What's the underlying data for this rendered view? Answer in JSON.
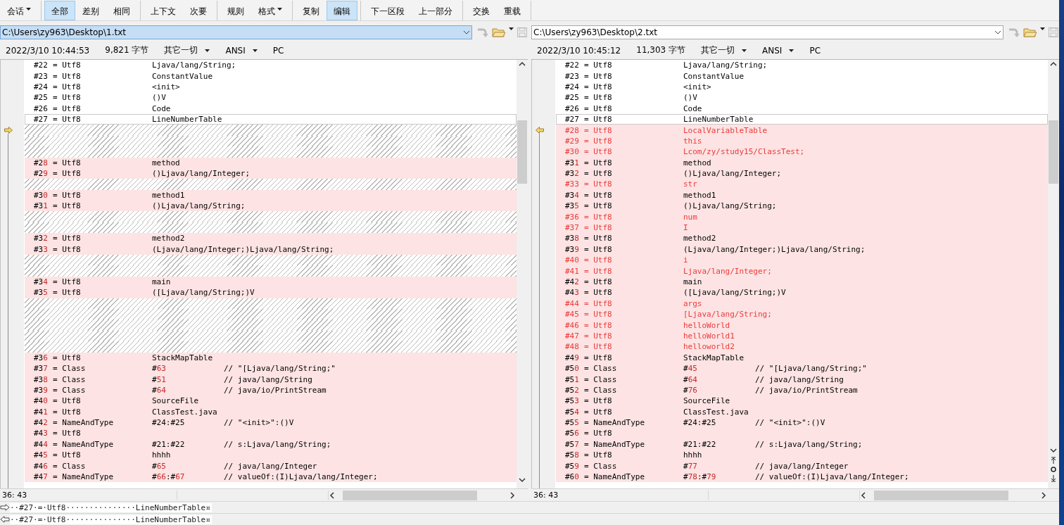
{
  "toolbar_groups": [
    {
      "buttons": [
        {
          "label": "会话",
          "dropdown": true,
          "selected": false
        }
      ]
    },
    {
      "buttons": [
        {
          "label": "全部",
          "dropdown": false,
          "selected": true
        },
        {
          "label": "差别",
          "dropdown": false,
          "selected": false
        },
        {
          "label": "相同",
          "dropdown": false,
          "selected": false
        }
      ]
    },
    {
      "buttons": [
        {
          "label": "上下文",
          "dropdown": false,
          "selected": false
        },
        {
          "label": "次要",
          "dropdown": false,
          "selected": false
        }
      ]
    },
    {
      "buttons": [
        {
          "label": "规则",
          "dropdown": false,
          "selected": false
        },
        {
          "label": "格式",
          "dropdown": true,
          "selected": false
        }
      ]
    },
    {
      "buttons": [
        {
          "label": "复制",
          "dropdown": false,
          "selected": false
        },
        {
          "label": "编辑",
          "dropdown": false,
          "selected": true
        }
      ]
    },
    {
      "buttons": [
        {
          "label": "下一区段",
          "dropdown": false,
          "selected": false
        },
        {
          "label": "上一部分",
          "dropdown": false,
          "selected": false
        }
      ]
    },
    {
      "buttons": [
        {
          "label": "交换",
          "dropdown": false,
          "selected": false
        },
        {
          "label": "重载",
          "dropdown": false,
          "selected": false
        }
      ]
    }
  ],
  "panes": [
    {
      "path": "C:\\Users\\zy963\\Desktop\\1.txt",
      "path_focused": true,
      "date": "2022/3/10 10:44:53",
      "size": "9,821 字节",
      "filter": "其它一切",
      "encoding": "ANSI",
      "line_ending": "PC",
      "marker_right": true,
      "position": "36: 43",
      "lines": [
        {
          "kind": "line",
          "changed": false,
          "added": false,
          "current": false,
          "id": "#22",
          "type": "= Utf8",
          "value": "Ljava/lang/String;"
        },
        {
          "kind": "line",
          "changed": false,
          "added": false,
          "current": false,
          "id": "#23",
          "type": "= Utf8",
          "value": "ConstantValue"
        },
        {
          "kind": "line",
          "changed": false,
          "added": false,
          "current": false,
          "id": "#24",
          "type": "= Utf8",
          "value": "<init>"
        },
        {
          "kind": "line",
          "changed": false,
          "added": false,
          "current": false,
          "id": "#25",
          "type": "= Utf8",
          "value": "()V"
        },
        {
          "kind": "line",
          "changed": false,
          "added": false,
          "current": false,
          "id": "#26",
          "type": "= Utf8",
          "value": "Code"
        },
        {
          "kind": "line",
          "changed": false,
          "added": false,
          "current": true,
          "id": "#27",
          "type": "= Utf8",
          "value": "LineNumberTable"
        },
        {
          "kind": "gap"
        },
        {
          "kind": "gap"
        },
        {
          "kind": "gap"
        },
        {
          "kind": "line",
          "changed": true,
          "added": false,
          "current": false,
          "id": "#2",
          "id_diff": "8",
          "type": "= Utf8",
          "value": "method"
        },
        {
          "kind": "line",
          "changed": true,
          "added": false,
          "current": false,
          "id": "#2",
          "id_diff": "9",
          "type": "= Utf8",
          "value": "()Ljava/lang/Integer;"
        },
        {
          "kind": "gap"
        },
        {
          "kind": "line",
          "changed": true,
          "added": false,
          "current": false,
          "id": "#3",
          "id_diff": "0",
          "type": "= Utf8",
          "value": "method1"
        },
        {
          "kind": "line",
          "changed": true,
          "added": false,
          "current": false,
          "id": "#3",
          "id_diff": "1",
          "type": "= Utf8",
          "value": "()Ljava/lang/String;"
        },
        {
          "kind": "gap"
        },
        {
          "kind": "gap"
        },
        {
          "kind": "line",
          "changed": true,
          "added": false,
          "current": false,
          "id": "#3",
          "id_diff": "2",
          "type": "= Utf8",
          "value": "method2"
        },
        {
          "kind": "line",
          "changed": true,
          "added": false,
          "current": false,
          "id": "#3",
          "id_diff": "3",
          "type": "= Utf8",
          "value": "(Ljava/lang/Integer;)Ljava/lang/String;"
        },
        {
          "kind": "gap"
        },
        {
          "kind": "gap"
        },
        {
          "kind": "line",
          "changed": true,
          "added": false,
          "current": false,
          "id": "#3",
          "id_diff": "4",
          "type": "= Utf8",
          "value": "main"
        },
        {
          "kind": "line",
          "changed": true,
          "added": false,
          "current": false,
          "id": "#3",
          "id_diff": "5",
          "type": "= Utf8",
          "value": "([Ljava/lang/String;)V"
        },
        {
          "kind": "gap"
        },
        {
          "kind": "gap"
        },
        {
          "kind": "gap"
        },
        {
          "kind": "gap"
        },
        {
          "kind": "gap"
        },
        {
          "kind": "line",
          "changed": true,
          "added": false,
          "current": false,
          "id": "#3",
          "id_diff": "6",
          "type": "= Utf8",
          "value": "StackMapTable"
        },
        {
          "kind": "line",
          "changed": true,
          "added": false,
          "current": false,
          "id": "#3",
          "id_diff": "7",
          "type": "= Class",
          "value_parts": [
            {
              "text": "#",
              "diff": false
            },
            {
              "text": "63",
              "diff": true
            }
          ],
          "comment": "// \"[Ljava/lang/String;\""
        },
        {
          "kind": "line",
          "changed": true,
          "added": false,
          "current": false,
          "id": "#3",
          "id_diff": "8",
          "type": "= Class",
          "value_parts": [
            {
              "text": "#",
              "diff": false
            },
            {
              "text": "51",
              "diff": true
            }
          ],
          "comment": "// java/lang/String"
        },
        {
          "kind": "line",
          "changed": true,
          "added": false,
          "current": false,
          "id": "#3",
          "id_diff": "9",
          "type": "= Class",
          "value_parts": [
            {
              "text": "#",
              "diff": false
            },
            {
              "text": "64",
              "diff": true
            }
          ],
          "comment": "// java/io/PrintStream"
        },
        {
          "kind": "line",
          "changed": true,
          "added": false,
          "current": false,
          "id": "#4",
          "id_diff": "0",
          "type": "= Utf8",
          "value": "SourceFile"
        },
        {
          "kind": "line",
          "changed": true,
          "added": false,
          "current": false,
          "id": "#4",
          "id_diff": "1",
          "type": "= Utf8",
          "value": "ClassTest.java"
        },
        {
          "kind": "line",
          "changed": true,
          "added": false,
          "current": false,
          "id": "#4",
          "id_diff": "2",
          "type": "= NameAndType",
          "value": "#24:#25",
          "comment": "// \"<init>\":()V"
        },
        {
          "kind": "line",
          "changed": true,
          "added": false,
          "current": false,
          "id": "#4",
          "id_diff": "3",
          "type": "= Utf8"
        },
        {
          "kind": "line",
          "changed": true,
          "added": false,
          "current": false,
          "id": "#4",
          "id_diff": "4",
          "type": "= NameAndType",
          "value": "#21:#22",
          "comment": "// s:Ljava/lang/String;"
        },
        {
          "kind": "line",
          "changed": true,
          "added": false,
          "current": false,
          "id": "#4",
          "id_diff": "5",
          "type": "= Utf8",
          "value": "hhhh"
        },
        {
          "kind": "line",
          "changed": true,
          "added": false,
          "current": false,
          "id": "#4",
          "id_diff": "6",
          "type": "= Class",
          "value_parts": [
            {
              "text": "#",
              "diff": false
            },
            {
              "text": "65",
              "diff": true
            }
          ],
          "comment": "// java/lang/Integer"
        },
        {
          "kind": "line",
          "changed": true,
          "added": false,
          "current": false,
          "id": "#4",
          "id_diff": "7",
          "type": "= NameAndType",
          "value_parts": [
            {
              "text": "#",
              "diff": false
            },
            {
              "text": "66",
              "diff": true
            },
            {
              "text": ":#",
              "diff": false
            },
            {
              "text": "67",
              "diff": true
            }
          ],
          "comment": "// valueOf:(I)Ljava/lang/Integer;"
        }
      ]
    },
    {
      "path": "C:\\Users\\zy963\\Desktop\\2.txt",
      "path_focused": false,
      "date": "2022/3/10 10:45:12",
      "size": "11,303 字节",
      "filter": "其它一切",
      "encoding": "ANSI",
      "line_ending": "PC",
      "marker_right": false,
      "position": "36: 43",
      "lines": [
        {
          "kind": "line",
          "changed": false,
          "added": false,
          "current": false,
          "id": "#22",
          "type": "= Utf8",
          "value": "Ljava/lang/String;"
        },
        {
          "kind": "line",
          "changed": false,
          "added": false,
          "current": false,
          "id": "#23",
          "type": "= Utf8",
          "value": "ConstantValue"
        },
        {
          "kind": "line",
          "changed": false,
          "added": false,
          "current": false,
          "id": "#24",
          "type": "= Utf8",
          "value": "<init>"
        },
        {
          "kind": "line",
          "changed": false,
          "added": false,
          "current": false,
          "id": "#25",
          "type": "= Utf8",
          "value": "()V"
        },
        {
          "kind": "line",
          "changed": false,
          "added": false,
          "current": false,
          "id": "#26",
          "type": "= Utf8",
          "value": "Code"
        },
        {
          "kind": "line",
          "changed": false,
          "added": false,
          "current": true,
          "id": "#27",
          "type": "= Utf8",
          "value": "LineNumberTable"
        },
        {
          "kind": "line",
          "changed": true,
          "added": true,
          "current": false,
          "id": "#28",
          "type": "= Utf8",
          "value": "LocalVariableTable"
        },
        {
          "kind": "line",
          "changed": true,
          "added": true,
          "current": false,
          "id": "#29",
          "type": "= Utf8",
          "value": "this"
        },
        {
          "kind": "line",
          "changed": true,
          "added": true,
          "current": false,
          "id": "#30",
          "type": "= Utf8",
          "value": "Lcom/zy/study15/ClassTest;"
        },
        {
          "kind": "line",
          "changed": true,
          "added": false,
          "current": false,
          "id": "#3",
          "id_diff": "1",
          "type": "= Utf8",
          "value": "method"
        },
        {
          "kind": "line",
          "changed": true,
          "added": false,
          "current": false,
          "id": "#3",
          "id_diff": "2",
          "type": "= Utf8",
          "value": "()Ljava/lang/Integer;"
        },
        {
          "kind": "line",
          "changed": true,
          "added": true,
          "current": false,
          "id": "#33",
          "type": "= Utf8",
          "value": "str"
        },
        {
          "kind": "line",
          "changed": true,
          "added": false,
          "current": false,
          "id": "#3",
          "id_diff": "4",
          "type": "= Utf8",
          "value": "method1"
        },
        {
          "kind": "line",
          "changed": true,
          "added": false,
          "current": false,
          "id": "#3",
          "id_diff": "5",
          "type": "= Utf8",
          "value": "()Ljava/lang/String;"
        },
        {
          "kind": "line",
          "changed": true,
          "added": true,
          "current": false,
          "id": "#36",
          "type": "= Utf8",
          "value": "num"
        },
        {
          "kind": "line",
          "changed": true,
          "added": true,
          "current": false,
          "id": "#37",
          "type": "= Utf8",
          "value": "I"
        },
        {
          "kind": "line",
          "changed": true,
          "added": false,
          "current": false,
          "id": "#3",
          "id_diff": "8",
          "type": "= Utf8",
          "value": "method2"
        },
        {
          "kind": "line",
          "changed": true,
          "added": false,
          "current": false,
          "id": "#3",
          "id_diff": "9",
          "type": "= Utf8",
          "value": "(Ljava/lang/Integer;)Ljava/lang/String;"
        },
        {
          "kind": "line",
          "changed": true,
          "added": true,
          "current": false,
          "id": "#40",
          "type": "= Utf8",
          "value": "i"
        },
        {
          "kind": "line",
          "changed": true,
          "added": true,
          "current": false,
          "id": "#41",
          "type": "= Utf8",
          "value": "Ljava/lang/Integer;"
        },
        {
          "kind": "line",
          "changed": true,
          "added": false,
          "current": false,
          "id": "#4",
          "id_diff": "2",
          "type": "= Utf8",
          "value": "main"
        },
        {
          "kind": "line",
          "changed": true,
          "added": false,
          "current": false,
          "id": "#4",
          "id_diff": "3",
          "type": "= Utf8",
          "value": "([Ljava/lang/String;)V"
        },
        {
          "kind": "line",
          "changed": true,
          "added": true,
          "current": false,
          "id": "#44",
          "type": "= Utf8",
          "value": "args"
        },
        {
          "kind": "line",
          "changed": true,
          "added": true,
          "current": false,
          "id": "#45",
          "type": "= Utf8",
          "value": "[Ljava/lang/String;"
        },
        {
          "kind": "line",
          "changed": true,
          "added": true,
          "current": false,
          "id": "#46",
          "type": "= Utf8",
          "value": "helloWorld"
        },
        {
          "kind": "line",
          "changed": true,
          "added": true,
          "current": false,
          "id": "#47",
          "type": "= Utf8",
          "value": "helloWorld1"
        },
        {
          "kind": "line",
          "changed": true,
          "added": true,
          "current": false,
          "id": "#48",
          "type": "= Utf8",
          "value": "helloworld2"
        },
        {
          "kind": "line",
          "changed": true,
          "added": false,
          "current": false,
          "id": "#4",
          "id_diff": "9",
          "type": "= Utf8",
          "value": "StackMapTable"
        },
        {
          "kind": "line",
          "changed": true,
          "added": false,
          "current": false,
          "id": "#5",
          "id_diff": "0",
          "type": "= Class",
          "value_parts": [
            {
              "text": "#",
              "diff": false
            },
            {
              "text": "45",
              "diff": true
            }
          ],
          "comment": "// \"[Ljava/lang/String;\""
        },
        {
          "kind": "line",
          "changed": true,
          "added": false,
          "current": false,
          "id": "#5",
          "id_diff": "1",
          "type": "= Class",
          "value_parts": [
            {
              "text": "#",
              "diff": false
            },
            {
              "text": "64",
              "diff": true
            }
          ],
          "comment": "// java/lang/String"
        },
        {
          "kind": "line",
          "changed": true,
          "added": false,
          "current": false,
          "id": "#5",
          "id_diff": "2",
          "type": "= Class",
          "value_parts": [
            {
              "text": "#",
              "diff": false
            },
            {
              "text": "76",
              "diff": true
            }
          ],
          "comment": "// java/io/PrintStream"
        },
        {
          "kind": "line",
          "changed": true,
          "added": false,
          "current": false,
          "id": "#5",
          "id_diff": "3",
          "type": "= Utf8",
          "value": "SourceFile"
        },
        {
          "kind": "line",
          "changed": true,
          "added": false,
          "current": false,
          "id": "#5",
          "id_diff": "4",
          "type": "= Utf8",
          "value": "ClassTest.java"
        },
        {
          "kind": "line",
          "changed": true,
          "added": false,
          "current": false,
          "id": "#5",
          "id_diff": "5",
          "type": "= NameAndType",
          "value": "#24:#25",
          "comment": "// \"<init>\":()V"
        },
        {
          "kind": "line",
          "changed": true,
          "added": false,
          "current": false,
          "id": "#5",
          "id_diff": "6",
          "type": "= Utf8"
        },
        {
          "kind": "line",
          "changed": true,
          "added": false,
          "current": false,
          "id": "#5",
          "id_diff": "7",
          "type": "= NameAndType",
          "value": "#21:#22",
          "comment": "// s:Ljava/lang/String;"
        },
        {
          "kind": "line",
          "changed": true,
          "added": false,
          "current": false,
          "id": "#5",
          "id_diff": "8",
          "type": "= Utf8",
          "value": "hhhh"
        },
        {
          "kind": "line",
          "changed": true,
          "added": false,
          "current": false,
          "id": "#5",
          "id_diff": "9",
          "type": "= Class",
          "value_parts": [
            {
              "text": "#",
              "diff": false
            },
            {
              "text": "77",
              "diff": true
            }
          ],
          "comment": "// java/lang/Integer"
        },
        {
          "kind": "line",
          "changed": true,
          "added": false,
          "current": false,
          "id": "#6",
          "id_diff": "0",
          "type": "= NameAndType",
          "value_parts": [
            {
              "text": "#",
              "diff": false
            },
            {
              "text": "78",
              "diff": true
            },
            {
              "text": ":#",
              "diff": false
            },
            {
              "text": "79",
              "diff": true
            }
          ],
          "comment": "// valueOf:(I)Ljava/lang/Integer;"
        }
      ]
    }
  ],
  "compare_lines": [
    {
      "points_right": true,
      "text": "··#27·=·Utf8···············LineNumberTable¤"
    },
    {
      "points_right": false,
      "text": "··#27·=·Utf8···············LineNumberTable¤"
    }
  ]
}
